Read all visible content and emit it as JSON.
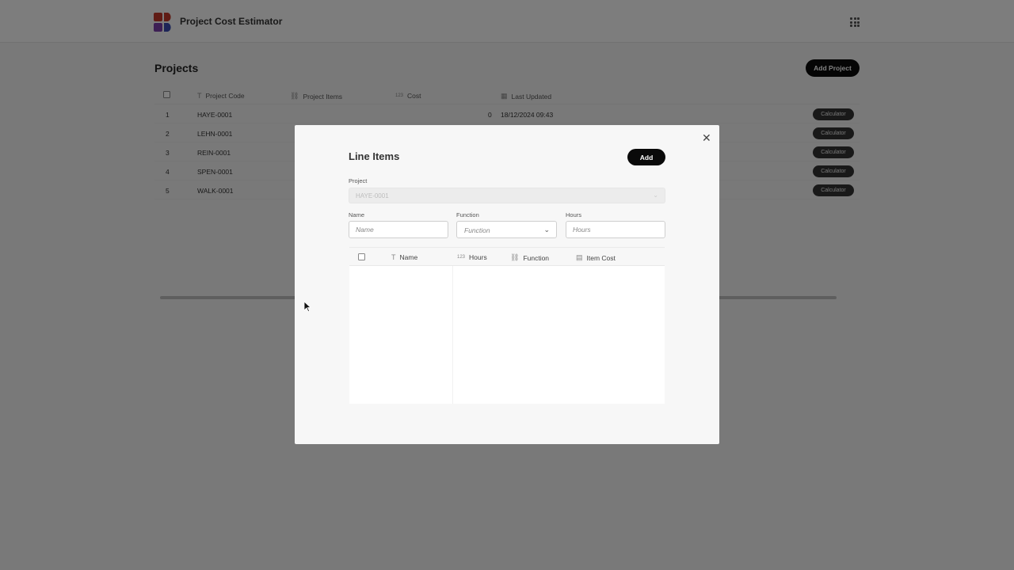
{
  "app": {
    "title": "Project Cost Estimator"
  },
  "page": {
    "title": "Projects",
    "add_project_label": "Add Project"
  },
  "table": {
    "columns": {
      "code": "Project Code",
      "items": "Project Items",
      "cost": "Cost",
      "updated": "Last Updated",
      "cost_icon": "123"
    },
    "rows": [
      {
        "num": "1",
        "code": "HAYE-0001",
        "cost": "0",
        "updated": "18/12/2024 09:43",
        "action": "Calculator"
      },
      {
        "num": "2",
        "code": "LEHN-0001",
        "cost": "",
        "updated": "",
        "action": "Calculator"
      },
      {
        "num": "3",
        "code": "REIN-0001",
        "cost": "",
        "updated": "",
        "action": "Calculator"
      },
      {
        "num": "4",
        "code": "SPEN-0001",
        "cost": "",
        "updated": "",
        "action": "Calculator"
      },
      {
        "num": "5",
        "code": "WALK-0001",
        "cost": "",
        "updated": "",
        "action": "Calculator"
      }
    ]
  },
  "modal": {
    "title": "Line Items",
    "add_label": "Add",
    "close_glyph": "✕",
    "project_label": "Project",
    "project_value": "HAYE-0001",
    "name_label": "Name",
    "name_placeholder": "Name",
    "function_label": "Function",
    "function_placeholder": "Function",
    "hours_label": "Hours",
    "hours_placeholder": "Hours",
    "columns": {
      "name": "Name",
      "hours": "Hours",
      "hours_icon": "123",
      "function": "Function",
      "item_cost": "Item Cost"
    }
  },
  "colors": {
    "accent_dark": "#0a0a0a",
    "logo_red": "#c0392b",
    "logo_blue": "#3b4bb0",
    "logo_purple": "#7a3fa8"
  }
}
